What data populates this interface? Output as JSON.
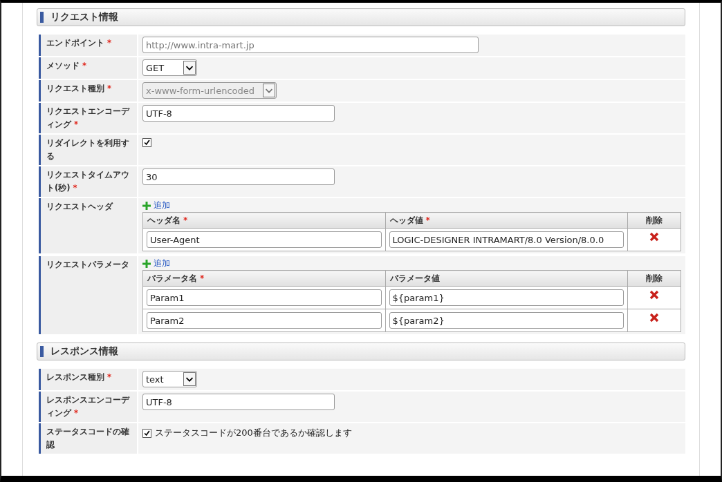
{
  "sections": [
    {
      "title": "リクエスト情報",
      "rows": [
        {
          "kind": "wide_text",
          "label": "エンドポイント",
          "required_mark": "*",
          "placeholder": "http://www.intra-mart.jp"
        },
        {
          "kind": "select",
          "label": "メソッド",
          "required_mark": "*",
          "value": "GET",
          "disabled": false
        },
        {
          "kind": "select",
          "label": "リクエスト種別",
          "required_mark": "*",
          "value": "x-www-form-urlencoded",
          "disabled": true
        },
        {
          "kind": "text",
          "label": "リクエストエンコーディング",
          "required_mark": "*",
          "value": "UTF-8"
        },
        {
          "kind": "checkbox",
          "label": "リダイレクトを利用する",
          "checked": true
        },
        {
          "kind": "text",
          "label": "リクエストタイムアウト(秒)",
          "required_mark": "*",
          "value": "30"
        },
        {
          "kind": "table",
          "label": "リクエストヘッダ",
          "add_link": "追加",
          "columns": [
            {
              "label": "ヘッダ名",
              "required_mark": "*"
            },
            {
              "label": "ヘッダ値",
              "required_mark": "*"
            }
          ],
          "delete_header": "削除",
          "rows": [
            [
              "User-Agent",
              "LOGIC-DESIGNER INTRAMART/8.0 Version/8.0.0"
            ]
          ]
        },
        {
          "kind": "table",
          "label": "リクエストパラメータ",
          "add_link": "追加",
          "columns": [
            {
              "label": "パラメータ名",
              "required_mark": "*"
            },
            {
              "label": "パラメータ値"
            }
          ],
          "delete_header": "削除",
          "rows": [
            [
              "Param1",
              "${param1}"
            ],
            [
              "Param2",
              "${param2}"
            ]
          ]
        }
      ]
    },
    {
      "title": "レスポンス情報",
      "rows": [
        {
          "kind": "select",
          "label": "レスポンス種別",
          "required_mark": "*",
          "value": "text",
          "disabled": false
        },
        {
          "kind": "text",
          "label": "レスポンスエンコーディング",
          "required_mark": "*",
          "value": "UTF-8"
        },
        {
          "kind": "checkbox",
          "label": "ステータスコードの確認",
          "checked": true,
          "text": "ステータスコードが200番台であるか確認します"
        }
      ]
    }
  ]
}
